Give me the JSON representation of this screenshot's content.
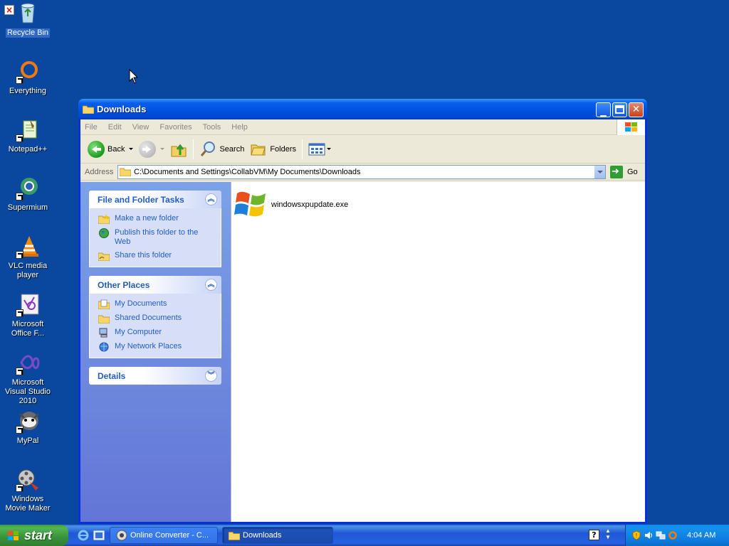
{
  "desktop": {
    "icons": [
      {
        "name": "recycle-bin",
        "label": "Recycle Bin"
      },
      {
        "name": "everything",
        "label": "Everything"
      },
      {
        "name": "notepadpp",
        "label": "Notepad++"
      },
      {
        "name": "supermium",
        "label": "Supermium"
      },
      {
        "name": "vlc",
        "label": "VLC media player"
      },
      {
        "name": "office",
        "label": "Microsoft Office F..."
      },
      {
        "name": "visual-studio",
        "label": "Microsoft Visual Studio 2010"
      },
      {
        "name": "mypal",
        "label": "MyPal"
      },
      {
        "name": "movie-maker",
        "label": "Windows Movie Maker"
      }
    ]
  },
  "window": {
    "title": "Downloads",
    "menu": [
      "File",
      "Edit",
      "View",
      "Favorites",
      "Tools",
      "Help"
    ],
    "toolbar": {
      "back": "Back",
      "search": "Search",
      "folders": "Folders"
    },
    "address": {
      "label": "Address",
      "path": "C:\\Documents and Settings\\CollabVM\\My Documents\\Downloads",
      "go": "Go"
    },
    "taskpane": {
      "file_tasks": {
        "title": "File and Folder Tasks",
        "links": [
          "Make a new folder",
          "Publish this folder to the Web",
          "Share this folder"
        ]
      },
      "other_places": {
        "title": "Other Places",
        "links": [
          "My Documents",
          "Shared Documents",
          "My Computer",
          "My Network Places"
        ]
      },
      "details": {
        "title": "Details"
      }
    },
    "files": [
      {
        "name": "windowsxpupdate.exe"
      }
    ]
  },
  "taskbar": {
    "start": "start",
    "tasks": [
      "Online Converter - C...",
      "Downloads"
    ],
    "clock": "4:04 AM"
  },
  "colors": {
    "desktop": "#0a48a0",
    "titlebar": "#0054e3",
    "taskpane_link": "#215dc6",
    "start_green": "#3a913a"
  }
}
